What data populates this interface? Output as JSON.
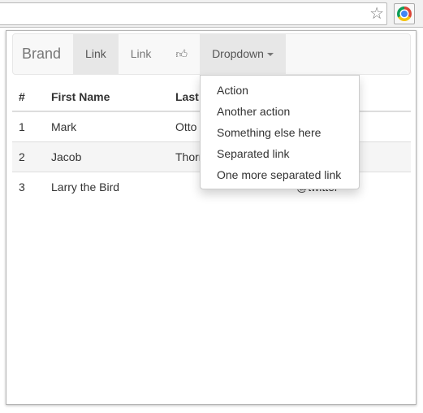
{
  "browser": {
    "star_icon": "star-icon",
    "extension_icon": "chrome-icon"
  },
  "navbar": {
    "brand": "Brand",
    "links": [
      {
        "label": "Link",
        "active": true
      },
      {
        "label": "Link",
        "active": false
      }
    ],
    "thumb_icon": "thumbs-up-icon",
    "dropdown": "Dropdown"
  },
  "dropdown_menu": [
    "Action",
    "Another action",
    "Something else here",
    "Separated link",
    "One more separated link"
  ],
  "table": {
    "headers": [
      "#",
      "First Name",
      "Last Name",
      ""
    ],
    "rows": [
      [
        "1",
        "Mark",
        "Otto",
        ""
      ],
      [
        "2",
        "Jacob",
        "Thornton",
        ""
      ],
      [
        "3",
        "Larry the Bird",
        "",
        "@twitter"
      ]
    ]
  }
}
